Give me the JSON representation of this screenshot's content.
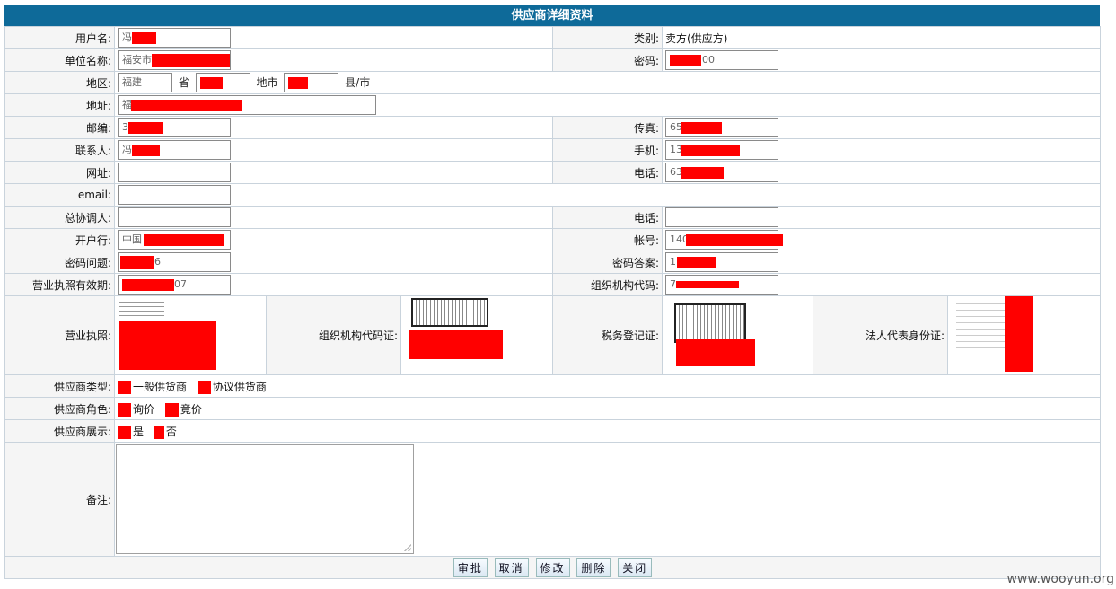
{
  "title": "供应商详细资料",
  "fields": {
    "username": {
      "label": "用户名:",
      "value": "冯"
    },
    "category": {
      "label": "类别:",
      "value": "卖方(供应方)"
    },
    "company": {
      "label": "单位名称:",
      "value": "福安市"
    },
    "password": {
      "label": "密码:",
      "value": "00"
    },
    "region": {
      "label": "地区:",
      "province": "福建",
      "province_suffix": "省",
      "city_suffix": "地市",
      "county_suffix": "县/市"
    },
    "address": {
      "label": "地址:",
      "value": "福"
    },
    "zipcode": {
      "label": "邮编:",
      "value": "3"
    },
    "fax": {
      "label": "传真:",
      "value": "65"
    },
    "contact": {
      "label": "联系人:",
      "value": "冯"
    },
    "mobile": {
      "label": "手机:",
      "value": "13"
    },
    "website": {
      "label": "网址:",
      "value": ""
    },
    "phone": {
      "label": "电话:",
      "value": "63"
    },
    "email": {
      "label": "email:",
      "value": ""
    },
    "coordinator": {
      "label": "总协调人:",
      "value": ""
    },
    "coordinator_phone": {
      "label": "电话:",
      "value": ""
    },
    "bank": {
      "label": "开户行:",
      "value": "中国"
    },
    "account": {
      "label": "帐号:",
      "value": "140"
    },
    "question": {
      "label": "密码问题:",
      "value": "6"
    },
    "answer": {
      "label": "密码答案:",
      "value": "1"
    },
    "license_expiry": {
      "label": "营业执照有效期:",
      "value": "07"
    },
    "org_code": {
      "label": "组织机构代码:",
      "value": "7"
    }
  },
  "documents": {
    "license": "营业执照:",
    "org_cert": "组织机构代码证:",
    "tax_cert": "税务登记证:",
    "legal_id": "法人代表身份证:"
  },
  "supplier_type": {
    "label": "供应商类型:",
    "options": [
      "一般供货商",
      "协议供货商"
    ]
  },
  "supplier_role": {
    "label": "供应商角色:",
    "options": [
      "询价",
      "竟价"
    ]
  },
  "supplier_show": {
    "label": "供应商展示:",
    "options": [
      "是",
      "否"
    ]
  },
  "remark": {
    "label": "备注:"
  },
  "buttons": [
    "审批",
    "取消",
    "修改",
    "删除",
    "关闭"
  ],
  "watermark": "www.wooyun.org",
  "colors": {
    "header": "#0e6a99",
    "redaction": "#ff0000"
  }
}
